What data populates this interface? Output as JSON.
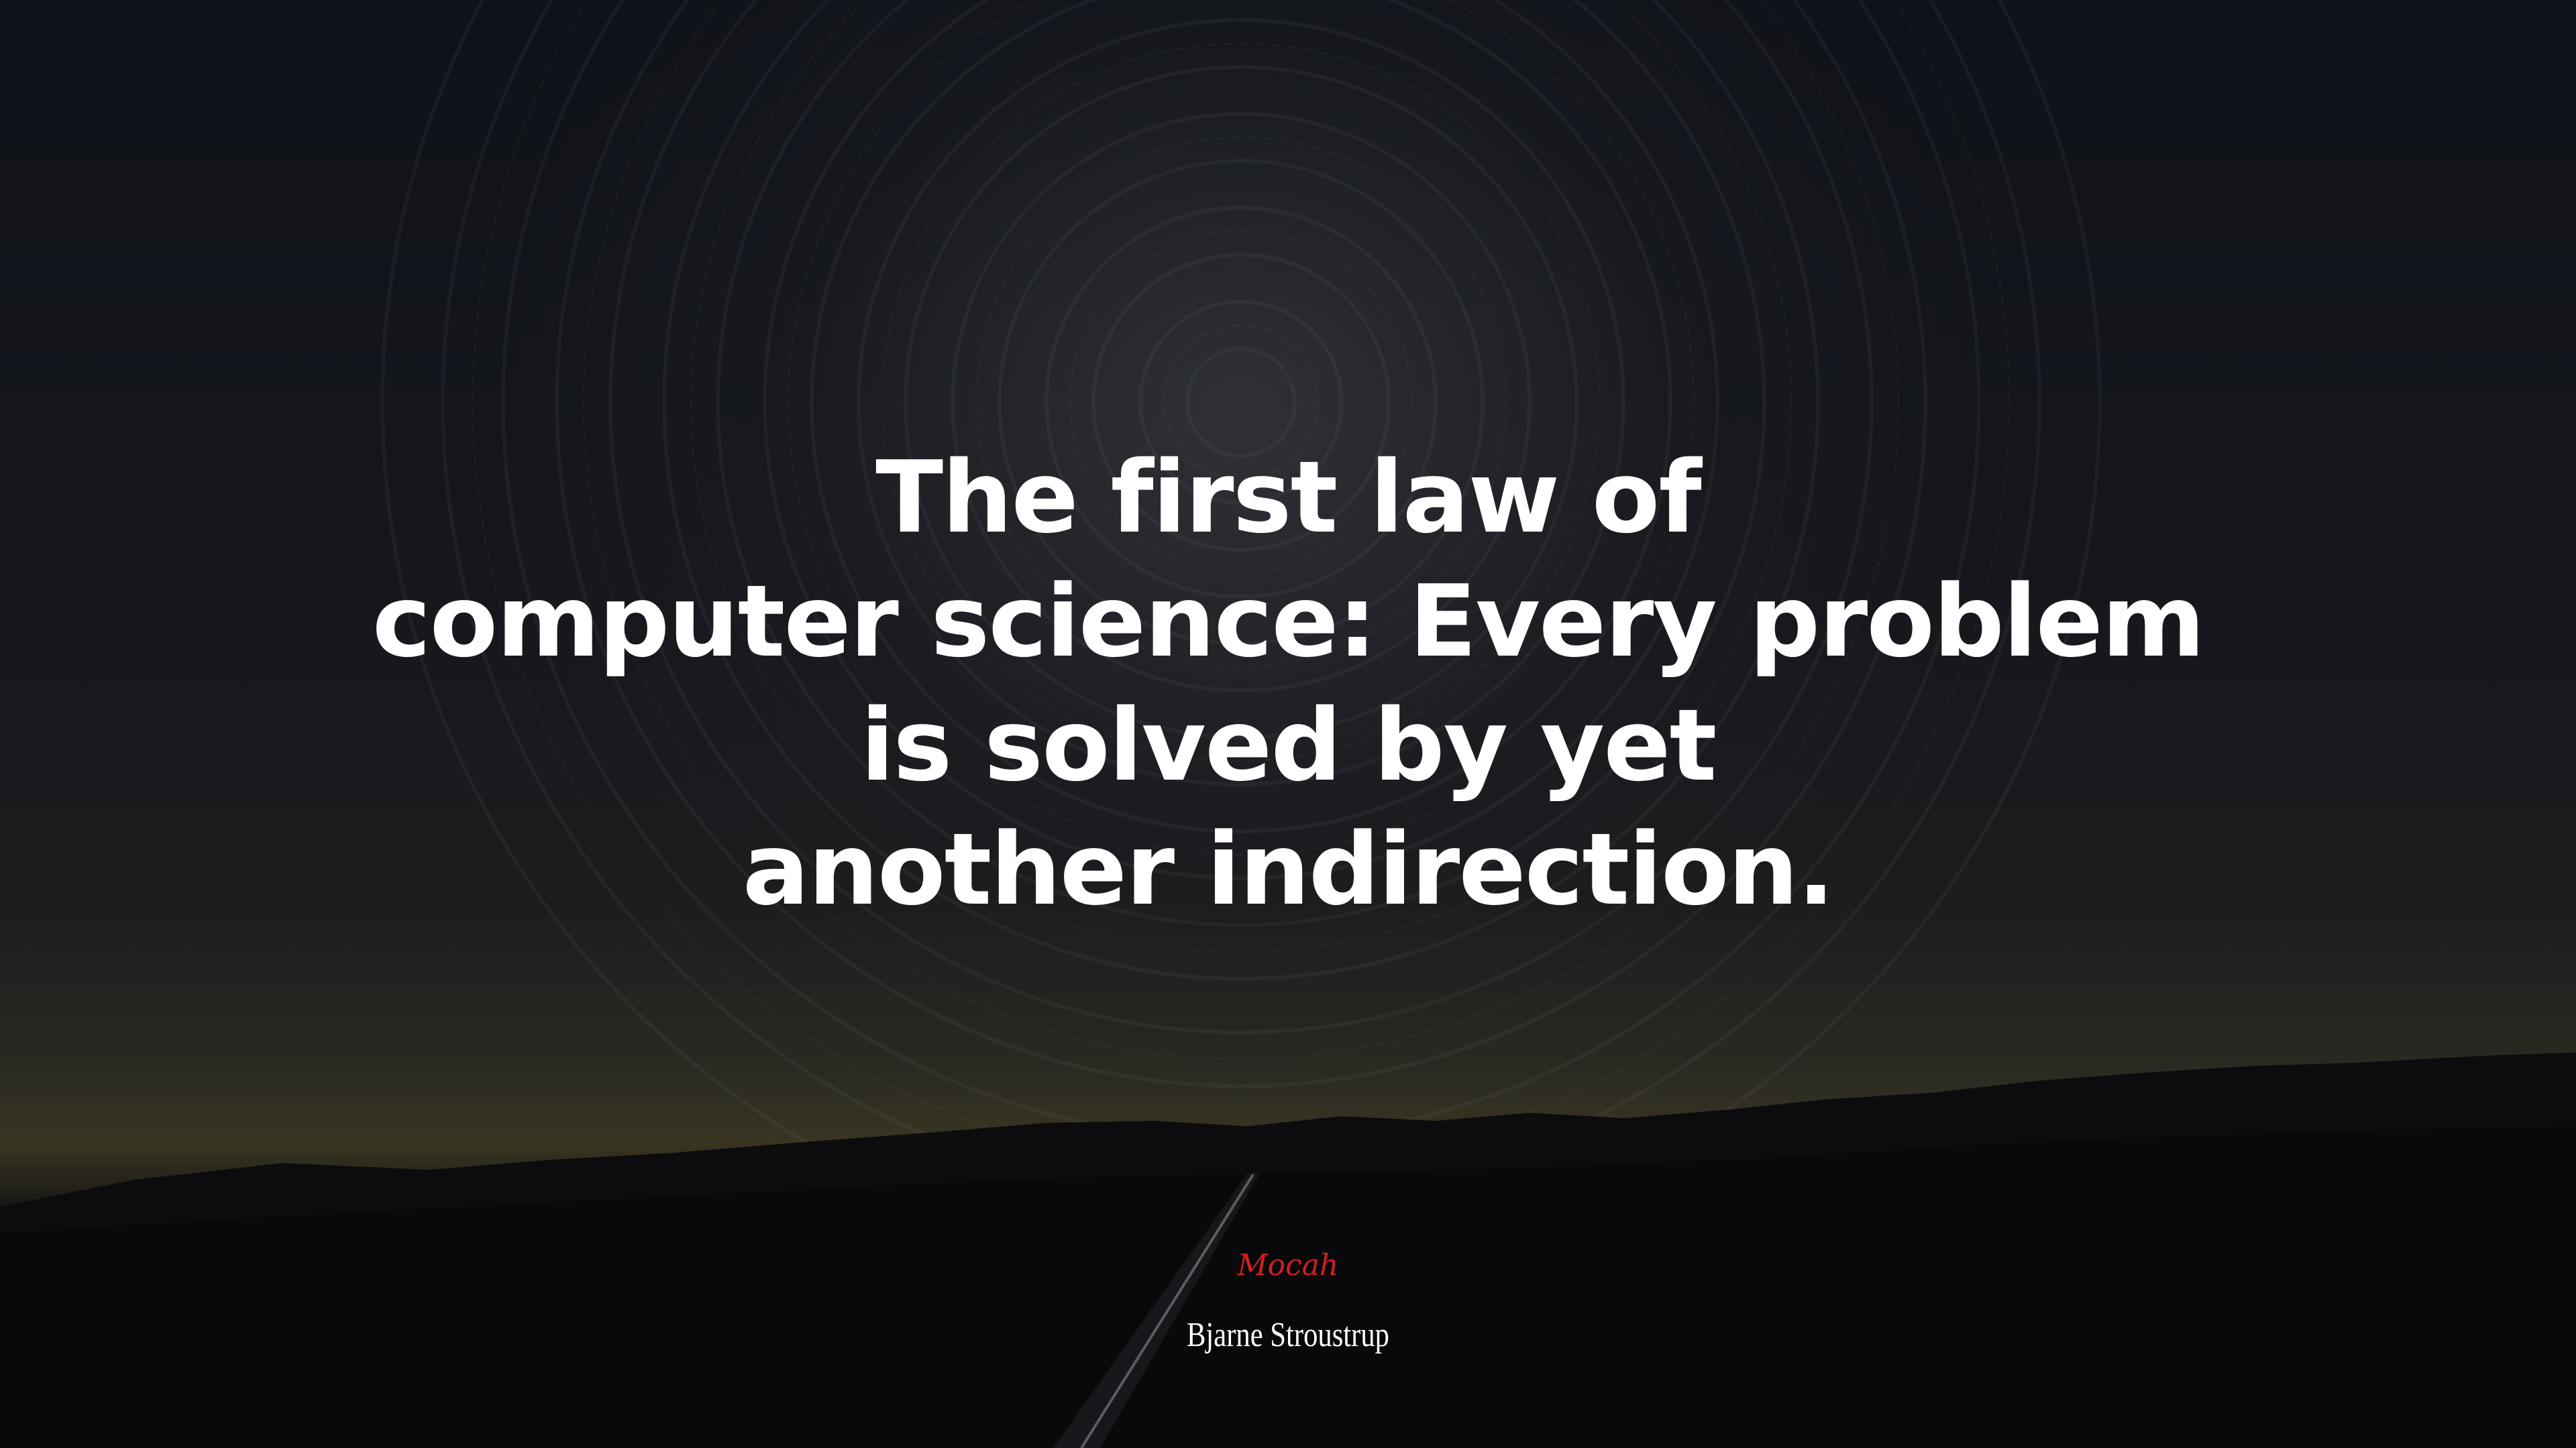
{
  "quote": {
    "lines": [
      "The first law of",
      "computer science: Every problem",
      "is solved by yet",
      "another indirection."
    ]
  },
  "brand": "Mocah",
  "author": "Bjarne Stroustrup",
  "colors": {
    "quote_text": "#ffffff",
    "brand_text": "#d21f1f",
    "author_text": "#ffffff"
  }
}
